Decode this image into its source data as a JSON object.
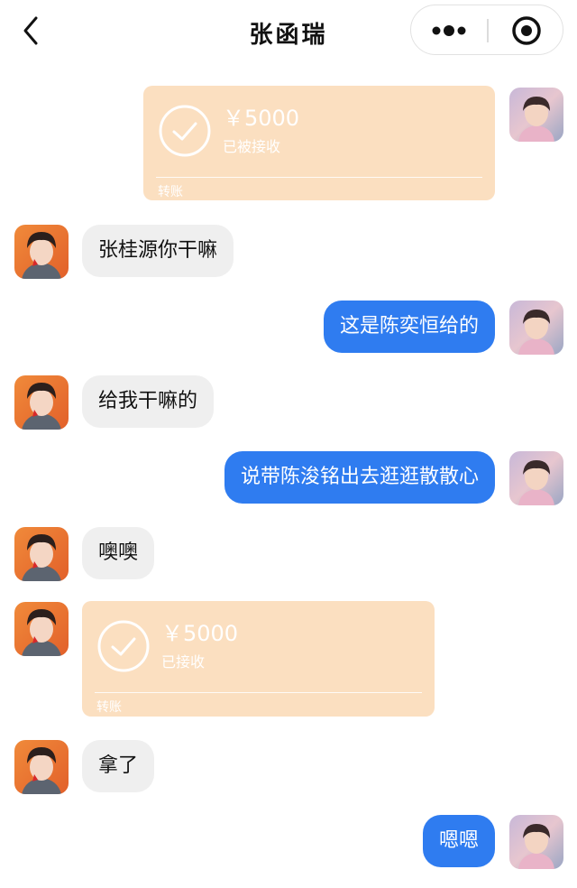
{
  "header": {
    "title": "张函瑞",
    "back_icon": "chevron-left-icon",
    "more_icon": "more-dots-icon",
    "close_icon": "target-close-icon"
  },
  "colors": {
    "blue_bubble": "#2f7cf0",
    "grey_bubble": "#efefef",
    "transfer_card": "#fbdfc0"
  },
  "messages": [
    {
      "side": "right",
      "type": "transfer",
      "amount": "￥5000",
      "status": "已被接收",
      "label": "转账"
    },
    {
      "side": "left",
      "type": "text",
      "text": "张桂源你干嘛"
    },
    {
      "side": "right",
      "type": "text",
      "text": "这是陈奕恒给的"
    },
    {
      "side": "left",
      "type": "text",
      "text": "给我干嘛的"
    },
    {
      "side": "right",
      "type": "text",
      "text": "说带陈浚铭出去逛逛散散心"
    },
    {
      "side": "left",
      "type": "text",
      "text": "噢噢"
    },
    {
      "side": "left",
      "type": "transfer",
      "amount": "￥5000",
      "status": "已接收",
      "label": "转账"
    },
    {
      "side": "left",
      "type": "text",
      "text": "拿了"
    },
    {
      "side": "right",
      "type": "text",
      "text": "嗯嗯"
    }
  ]
}
